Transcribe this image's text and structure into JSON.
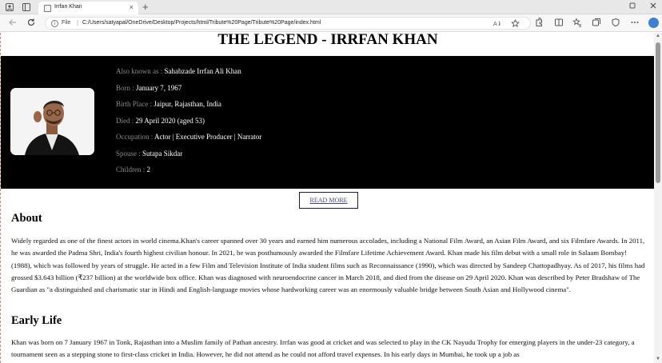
{
  "browser": {
    "tab_title": "Irrfan Khan",
    "tab_close": "×",
    "new_tab": "+",
    "file_label": "File",
    "url": "C:/Users/satyapal/OneDrive/Desktop/Projects/html/Tribute%20Page/Tribute%20Page/index.html"
  },
  "page": {
    "title": "THE LEGEND - IRRFAN KHAN",
    "facts": [
      {
        "label": "Also known as : ",
        "value": "Sahabzade Irrfan Ali Khan"
      },
      {
        "label": "Born : ",
        "value": "January 7, 1967"
      },
      {
        "label": "Birth Place : ",
        "value": "Jaipur, Rajasthan, India"
      },
      {
        "label": "Died : ",
        "value": "29 April 2020 (aged 53)"
      },
      {
        "label": "Occupation : ",
        "value": "Actor | Executive Producer | Narrator"
      },
      {
        "label": "Spouse : ",
        "value": "Sutapa Sikdar"
      },
      {
        "label": "Children : ",
        "value": "2"
      }
    ],
    "read_more": "READ MORE",
    "about_heading": "About",
    "about_text": "Widely regarded as one of the finest actors in world cinema.Khan's career spanned over 30 years and earned him numerous accolades, including a National Film Award, an Asian Film Award, and six Filmfare Awards. In 2011, he was awarded the Padma Shri, India's fourth highest civilian honour. In 2021, he was posthumously awarded the Filmfare Lifetime Achievement Award. Khan made his film debut with a small role in Salaam Bombay! (1988), which was followed by years of struggle. He acted in a few Film and Television Institute of India student films such as Reconnaissance (1990), which was directed by Sandeep Chattopadhyay. As of 2017, his films had grossed $3.643 billion (₹237 billion) at the worldwide box office. Khan was diagnosed with neuroendocrine cancer in March 2018, and died from the disease on 29 April 2020. Khan was described by Peter Bradshaw of The Guardian as \"a distinguished and charismatic star in Hindi and English-language movies whose hardworking career was an enormously valuable bridge between South Asian and Hollywood cinema\".",
    "early_heading": "Early Life",
    "early_text": "Khan was born on 7 January 1967 in Tonk, Rajasthan into a Muslim family of Pathan ancestry. Irrfan was good at cricket and was selected to play in the CK Nayudu Trophy for emerging players in the under-23 category, a tournament seen as a stepping stone to first-class cricket in India. However, he did not attend as he could not afford travel expenses. In his early days in Mumbai, he took up a job as"
  }
}
